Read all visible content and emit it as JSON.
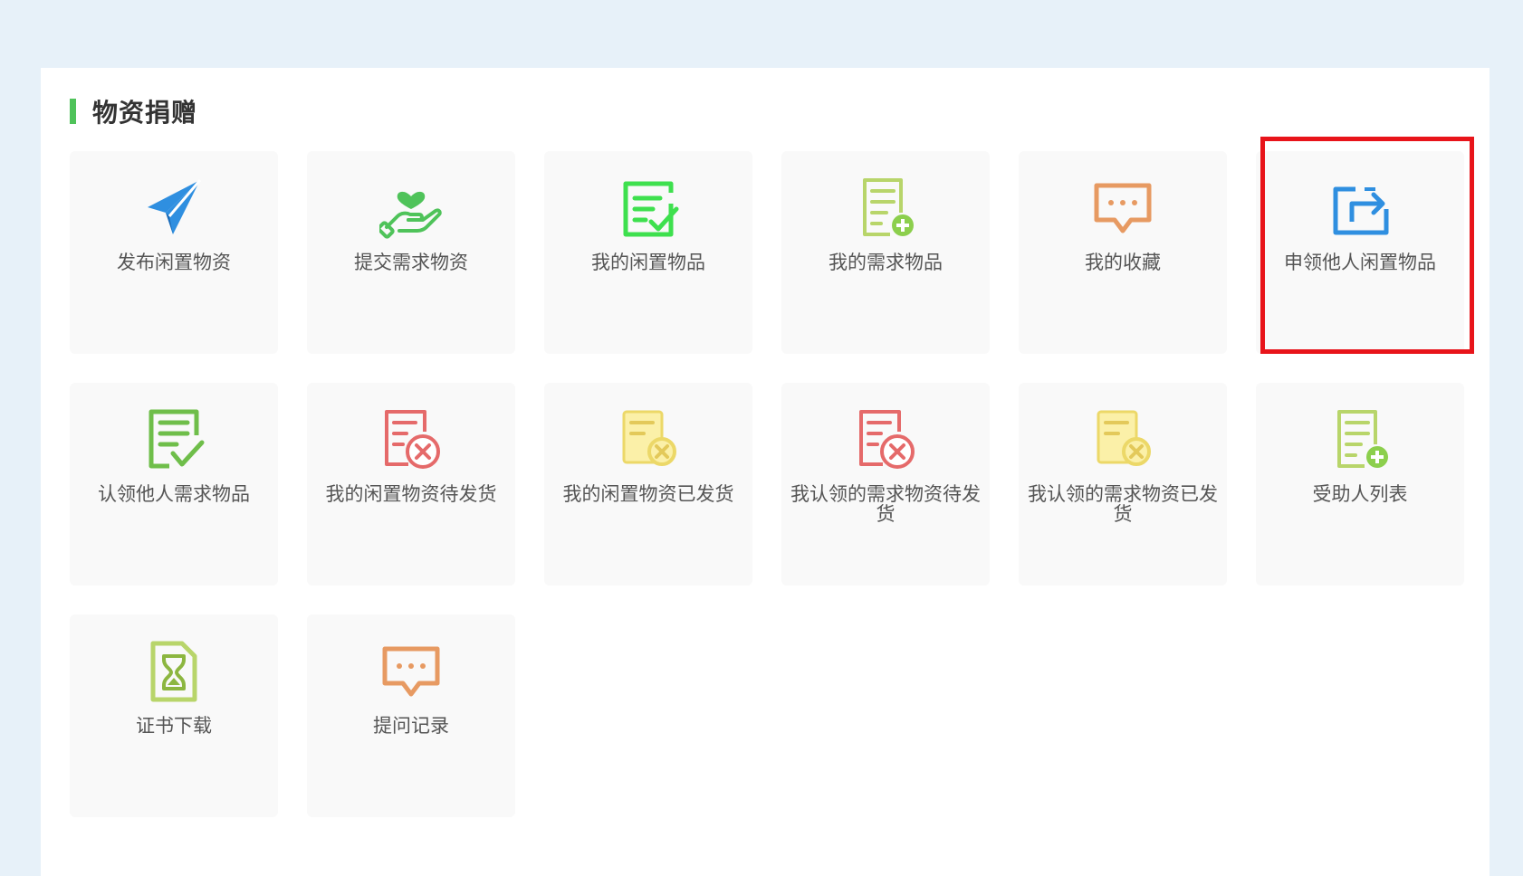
{
  "section": {
    "title": "物资捐赠"
  },
  "colors": {
    "background": "#e7f1f9",
    "panel": "#ffffff",
    "title_accent": "#4fc35a",
    "card_bg": "#f9f9f9",
    "highlight": "#e8141a",
    "label_text": "#555555"
  },
  "cards": [
    {
      "label": "发布闲置物资",
      "icon": "paper-plane-icon"
    },
    {
      "label": "提交需求物资",
      "icon": "hand-heart-icon"
    },
    {
      "label": "我的闲置物品",
      "icon": "edit-check-icon"
    },
    {
      "label": "我的需求物品",
      "icon": "document-plus-icon"
    },
    {
      "label": "我的收藏",
      "icon": "chat-bubble-icon"
    },
    {
      "label": "申领他人闲置物品",
      "icon": "share-folder-icon"
    },
    {
      "label": "认领他人需求物品",
      "icon": "document-check-icon"
    },
    {
      "label": "我的闲置物资待发货",
      "icon": "document-cancel-icon"
    },
    {
      "label": "我的闲置物资已发货",
      "icon": "document-cancel-yellow-icon"
    },
    {
      "label": "我认领的需求物资待发货",
      "icon": "document-cancel-icon"
    },
    {
      "label": "我认领的需求物资已发货",
      "icon": "document-cancel-yellow-icon"
    },
    {
      "label": "受助人列表",
      "icon": "document-plus-icon"
    },
    {
      "label": "证书下载",
      "icon": "hourglass-document-icon"
    },
    {
      "label": "提问记录",
      "icon": "chat-bubble-icon"
    }
  ]
}
